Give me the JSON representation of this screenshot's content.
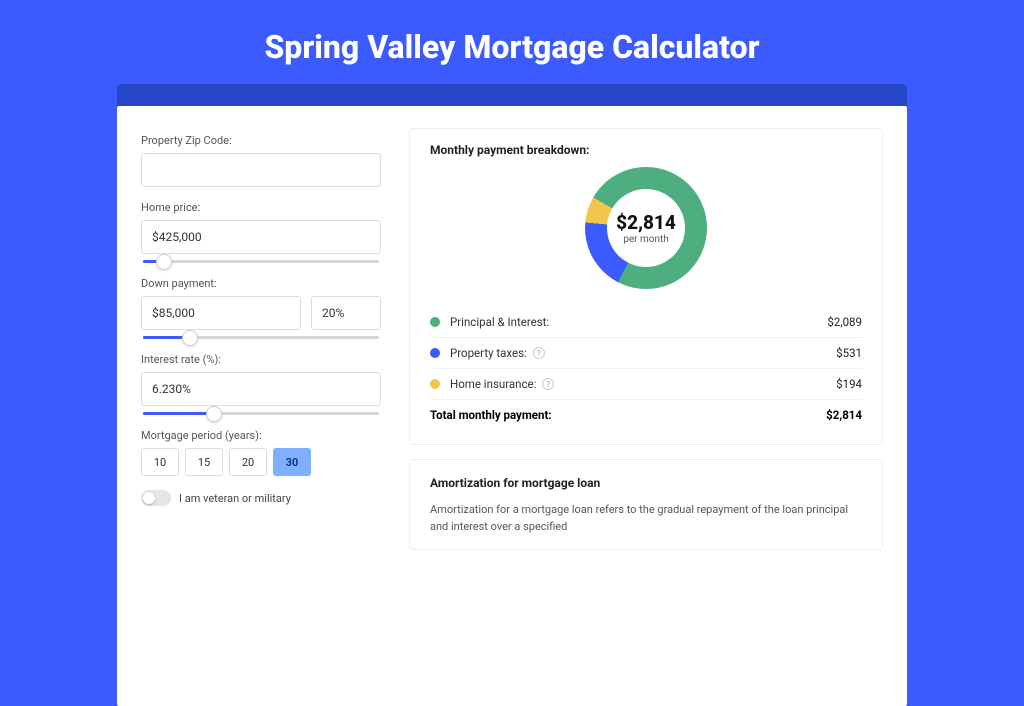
{
  "page": {
    "title": "Spring Valley Mortgage Calculator"
  },
  "form": {
    "zip": {
      "label": "Property Zip Code:",
      "value": ""
    },
    "price": {
      "label": "Home price:",
      "value": "$425,000",
      "slider_pct": 9
    },
    "down": {
      "label": "Down payment:",
      "value": "$85,000",
      "pct": "20%",
      "slider_pct": 20
    },
    "rate": {
      "label": "Interest rate (%):",
      "value": "6.230%",
      "slider_pct": 30
    },
    "period": {
      "label": "Mortgage period (years):",
      "options": [
        "10",
        "15",
        "20",
        "30"
      ],
      "selected": "30"
    },
    "vet": {
      "label": "I am veteran or military",
      "on": false
    }
  },
  "breakdown": {
    "title": "Monthly payment breakdown:",
    "center_amount": "$2,814",
    "center_sub": "per month",
    "items": [
      {
        "label": "Principal & Interest:",
        "value": "$2,089",
        "color": "#4fae80",
        "help": false
      },
      {
        "label": "Property taxes:",
        "value": "$531",
        "color": "#3b5bff",
        "help": true
      },
      {
        "label": "Home insurance:",
        "value": "$194",
        "color": "#f1c64c",
        "help": true
      }
    ],
    "total": {
      "label": "Total monthly payment:",
      "value": "$2,814"
    }
  },
  "amort": {
    "title": "Amortization for mortgage loan",
    "body": "Amortization for a mortgage loan refers to the gradual repayment of the loan principal and interest over a specified"
  },
  "colors": {
    "green": "#4fae80",
    "blue": "#3b5bff",
    "yellow": "#f1c64c"
  },
  "chart_data": {
    "type": "pie",
    "title": "Monthly payment breakdown",
    "center_label": "$2,814 per month",
    "series": [
      {
        "name": "Principal & Interest",
        "value": 2089,
        "color": "#4fae80"
      },
      {
        "name": "Property taxes",
        "value": 531,
        "color": "#3b5bff"
      },
      {
        "name": "Home insurance",
        "value": 194,
        "color": "#f1c64c"
      }
    ],
    "total": 2814
  }
}
